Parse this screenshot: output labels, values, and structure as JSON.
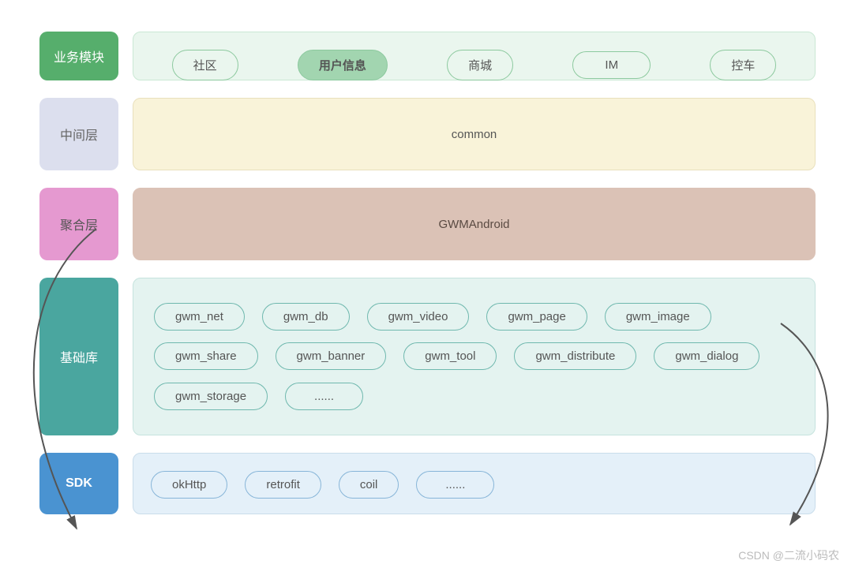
{
  "layers": {
    "business": {
      "label": "业务模块",
      "items": [
        "社区",
        "用户信息",
        "商城",
        "IM",
        "控车"
      ],
      "active_index": 1
    },
    "middle": {
      "label": "中间层",
      "content": "common"
    },
    "aggregate": {
      "label": "聚合层",
      "content": "GWMAndroid"
    },
    "base": {
      "label": "基础库",
      "items": [
        "gwm_net",
        "gwm_db",
        "gwm_video",
        "gwm_page",
        "gwm_image",
        "gwm_share",
        "gwm_banner",
        "gwm_tool",
        "gwm_distribute",
        "gwm_dialog",
        "gwm_storage",
        "......"
      ]
    },
    "sdk": {
      "label": "SDK",
      "items": [
        "okHttp",
        "retrofit",
        "coil",
        "......"
      ]
    }
  },
  "colors": {
    "green": "#56ae6c",
    "pink": "#e599d0",
    "teal": "#4aa69f",
    "blue": "#4a93d1",
    "lavender": "#dcdfee",
    "tan": "#dbc2b6"
  },
  "watermark": "CSDN @二流小码农"
}
